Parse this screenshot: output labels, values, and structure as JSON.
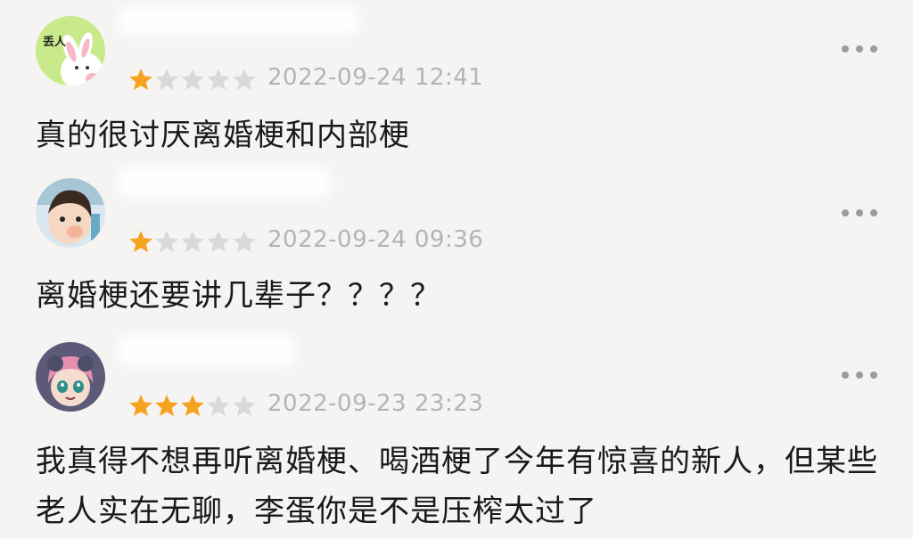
{
  "comments": [
    {
      "avatar_label": "丢人",
      "rating": 1,
      "max_rating": 5,
      "timestamp": "2022-09-24 12:41",
      "text": "真的很讨厌离婚梗和内部梗"
    },
    {
      "rating": 1,
      "max_rating": 5,
      "timestamp": "2022-09-24 09:36",
      "text": "离婚梗还要讲几辈子？？？？"
    },
    {
      "rating": 3,
      "max_rating": 5,
      "timestamp": "2022-09-23 23:23",
      "text": "我真得不想再听离婚梗、喝酒梗了今年有惊喜的新人，但某些老人实在无聊，李蛋你是不是压榨太过了"
    }
  ],
  "colors": {
    "background": "#f5f4f2",
    "star_filled": "#f6a21f",
    "star_empty": "#d9d9d9",
    "timestamp": "#b4b4b4",
    "text": "#1a1a1a",
    "more_dots": "#9b9b9b"
  },
  "icons": {
    "more": "more-horizontal-icon",
    "star": "star-icon"
  }
}
